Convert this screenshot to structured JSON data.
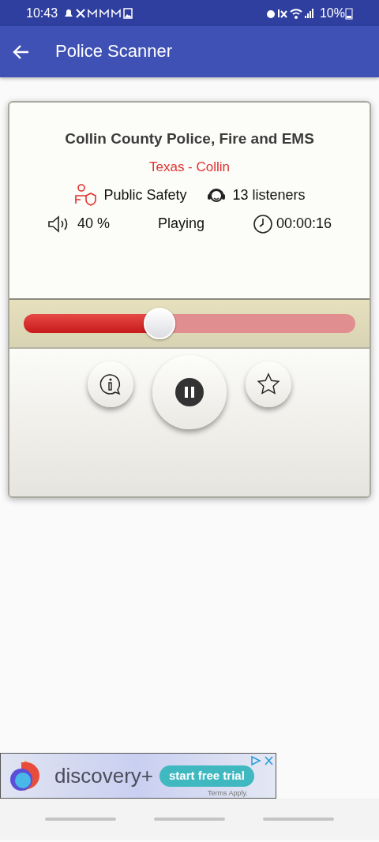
{
  "status_bar": {
    "time": "10:43",
    "battery": "10%"
  },
  "app_bar": {
    "title": "Police Scanner"
  },
  "station": {
    "name": "Collin County Police, Fire and EMS",
    "location": "Texas - Collin",
    "category": "Public Safety",
    "listeners": "13 listeners",
    "volume": "40 %",
    "state": "Playing",
    "elapsed": "00:00:16"
  },
  "slider": {
    "level": 0.41
  },
  "controls": {
    "playing": true,
    "favorite": false
  },
  "ad": {
    "brand": "discovery+",
    "cta": "start free trial",
    "terms": "Terms Apply."
  }
}
